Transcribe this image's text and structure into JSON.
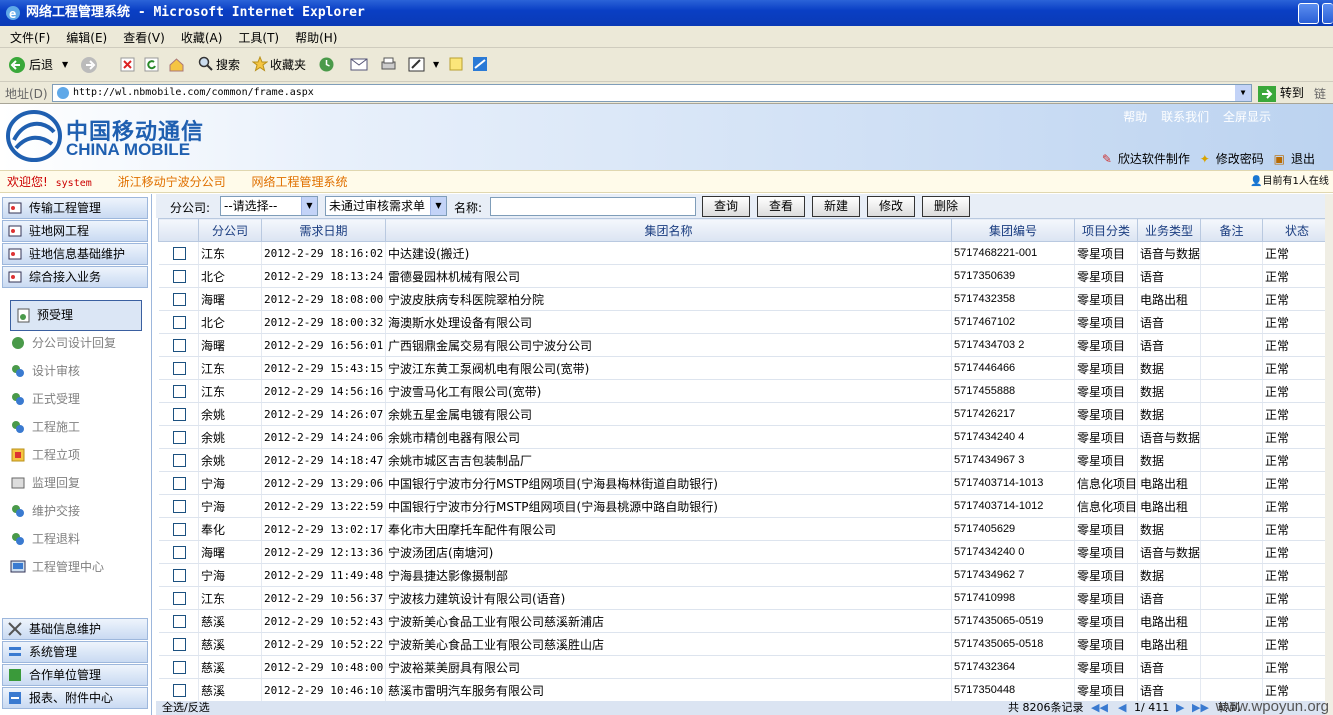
{
  "window": {
    "title": "网络工程管理系统 - Microsoft Internet Explorer"
  },
  "menu": [
    "文件(F)",
    "编辑(E)",
    "查看(V)",
    "收藏(A)",
    "工具(T)",
    "帮助(H)"
  ],
  "toolbar": {
    "back": "后退",
    "search": "搜索",
    "favorites": "收藏夹"
  },
  "address": {
    "label": "地址(D)",
    "url": "http://wl.nbmobile.com/common/frame.aspx",
    "go": "转到",
    "links": "链"
  },
  "header": {
    "logo_cn": "中国移动通信",
    "logo_en": "CHINA MOBILE",
    "links": [
      "帮助",
      "联系我们",
      "全屏显示"
    ],
    "bottom_links": [
      "欣达软件制作",
      "修改密码",
      "退出"
    ],
    "colors": {
      "brand": "#1f5fb0",
      "header_bg": "#bcd3f0"
    }
  },
  "welcome": {
    "greeting": "欢迎您!",
    "user": "system",
    "company": "浙江移动宁波分公司",
    "system_name": "网络工程管理系统",
    "online": "目前有1人在线"
  },
  "sidebar": {
    "top": [
      "传输工程管理",
      "驻地网工程",
      "驻地信息基础维护",
      "综合接入业务"
    ],
    "selected": "预受理",
    "items": [
      "分公司设计回复",
      "设计审核",
      "正式受理",
      "工程施工",
      "工程立项",
      "监理回复",
      "维护交接",
      "工程退料",
      "工程管理中心"
    ],
    "bottom": [
      "基础信息维护",
      "系统管理",
      "合作单位管理",
      "报表、附件中心"
    ]
  },
  "filter": {
    "branch_label": "分公司:",
    "branch_value": "--请选择--",
    "status_value": "未通过审核需求单",
    "name_label": "名称:",
    "buttons": [
      "查询",
      "查看",
      "新建",
      "修改",
      "删除"
    ]
  },
  "table": {
    "headers": [
      "",
      "分公司",
      "需求日期",
      "集团名称",
      "集团编号",
      "项目分类",
      "业务类型",
      "备注",
      "状态"
    ],
    "rows": [
      [
        "江东",
        "2012-2-29 18:16:02",
        "中达建设(搬迁)",
        "5717468221-001",
        "零星项目",
        "语音与数据",
        "",
        "正常"
      ],
      [
        "北仑",
        "2012-2-29 18:13:24",
        "雷德曼园林机械有限公司",
        "5717350639",
        "零星项目",
        "语音",
        "",
        "正常"
      ],
      [
        "海曙",
        "2012-2-29 18:08:00",
        "宁波皮肤病专科医院翠柏分院",
        "5717432358",
        "零星项目",
        "电路出租",
        "",
        "正常"
      ],
      [
        "北仑",
        "2012-2-29 18:00:32",
        "海澳斯水处理设备有限公司",
        "5717467102",
        "零星项目",
        "语音",
        "",
        "正常"
      ],
      [
        "海曙",
        "2012-2-29 16:56:01",
        "广西铟鼎金属交易有限公司宁波分公司",
        "5717434703 2",
        "零星项目",
        "语音",
        "",
        "正常"
      ],
      [
        "江东",
        "2012-2-29 15:43:15",
        "宁波江东黄工泵阀机电有限公司(宽带)",
        "5717446466",
        "零星项目",
        "数据",
        "",
        "正常"
      ],
      [
        "江东",
        "2012-2-29 14:56:16",
        "宁波雪马化工有限公司(宽带)",
        "5717455888",
        "零星项目",
        "数据",
        "",
        "正常"
      ],
      [
        "余姚",
        "2012-2-29 14:26:07",
        "余姚五星金属电镀有限公司",
        "5717426217",
        "零星项目",
        "数据",
        "",
        "正常"
      ],
      [
        "余姚",
        "2012-2-29 14:24:06",
        "余姚市精创电器有限公司",
        "5717434240 4",
        "零星项目",
        "语音与数据",
        "",
        "正常"
      ],
      [
        "余姚",
        "2012-2-29 14:18:47",
        "余姚市城区吉吉包装制品厂",
        "5717434967 3",
        "零星项目",
        "数据",
        "",
        "正常"
      ],
      [
        "宁海",
        "2012-2-29 13:29:06",
        "中国银行宁波市分行MSTP组网项目(宁海县梅林街道自助银行)",
        "5717403714-1013",
        "信息化项目",
        "电路出租",
        "",
        "正常"
      ],
      [
        "宁海",
        "2012-2-29 13:22:59",
        "中国银行宁波市分行MSTP组网项目(宁海县桃源中路自助银行)",
        "5717403714-1012",
        "信息化项目",
        "电路出租",
        "",
        "正常"
      ],
      [
        "奉化",
        "2012-2-29 13:02:17",
        "奉化市大田摩托车配件有限公司",
        "5717405629",
        "零星项目",
        "数据",
        "",
        "正常"
      ],
      [
        "海曙",
        "2012-2-29 12:13:36",
        "宁波汤团店(南塘河)",
        "5717434240 0",
        "零星项目",
        "语音与数据",
        "",
        "正常"
      ],
      [
        "宁海",
        "2012-2-29 11:49:48",
        "宁海县捷达影像摄制部",
        "5717434962 7",
        "零星项目",
        "数据",
        "",
        "正常"
      ],
      [
        "江东",
        "2012-2-29 10:56:37",
        "宁波核力建筑设计有限公司(语音)",
        "5717410998",
        "零星项目",
        "语音",
        "",
        "正常"
      ],
      [
        "慈溪",
        "2012-2-29 10:52:43",
        "宁波新美心食品工业有限公司慈溪新浦店",
        "5717435065-0519",
        "零星项目",
        "电路出租",
        "",
        "正常"
      ],
      [
        "慈溪",
        "2012-2-29 10:52:22",
        "宁波新美心食品工业有限公司慈溪胜山店",
        "5717435065-0518",
        "零星项目",
        "电路出租",
        "",
        "正常"
      ],
      [
        "慈溪",
        "2012-2-29 10:48:00",
        "宁波裕莱美厨具有限公司",
        "5717432364",
        "零星项目",
        "语音",
        "",
        "正常"
      ],
      [
        "慈溪",
        "2012-2-29 10:46:10",
        "慈溪市雷明汽车服务有限公司",
        "5717350448",
        "零星项目",
        "语音",
        "",
        "正常"
      ]
    ]
  },
  "footer": {
    "select": "全选/反选",
    "total": "共 8206条记录",
    "page": "1/ 411",
    "goto": "转到"
  },
  "watermark": "www.wpoyun.org"
}
